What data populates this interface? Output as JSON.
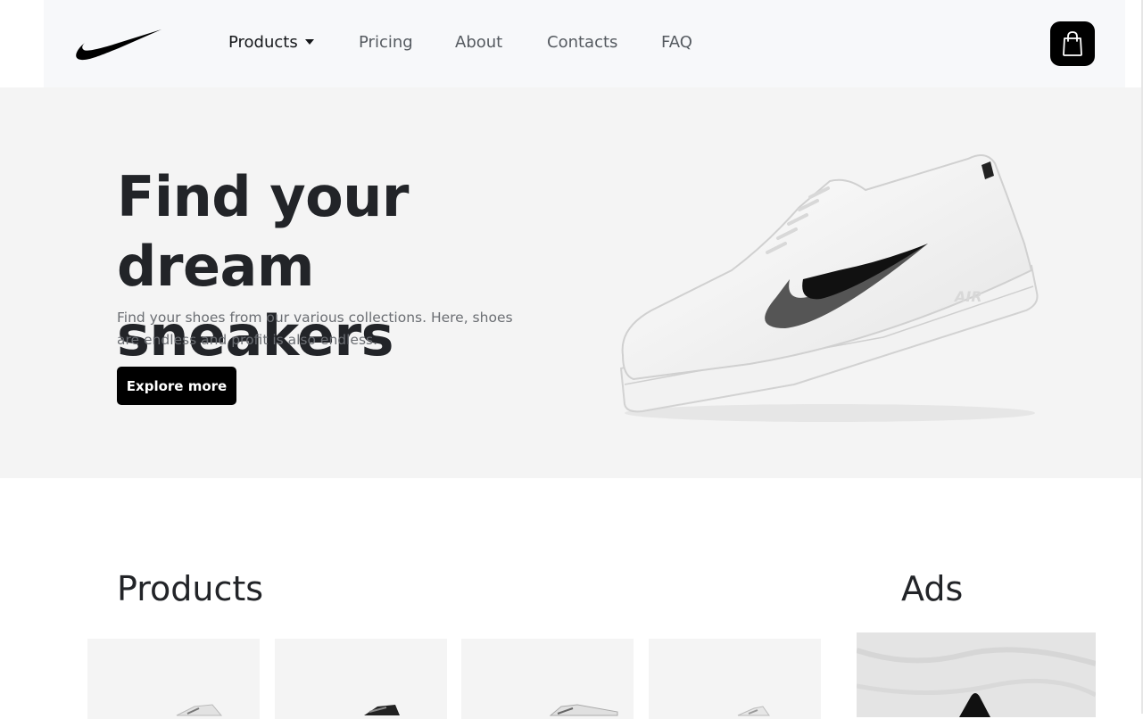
{
  "nav": {
    "logo_icon": "nike-swoosh-logo",
    "items": [
      {
        "label": "Products",
        "active": true,
        "has_dropdown": true
      },
      {
        "label": "Pricing"
      },
      {
        "label": "About"
      },
      {
        "label": "Contacts"
      },
      {
        "label": "FAQ"
      }
    ],
    "cart_icon": "shopping-bag-icon"
  },
  "hero": {
    "title": "Find your dream sneakers",
    "subtitle": "Find your shoes from our various collections. Here, shoes are endless and profit is also endless.",
    "button_label": "Explore more",
    "image_icon": "white-sneaker-image"
  },
  "products": {
    "title": "Products",
    "cards": [
      {
        "image": "sneaker-image-1"
      },
      {
        "image": "sneaker-image-2"
      },
      {
        "image": "sneaker-image-3"
      },
      {
        "image": "sneaker-image-4"
      }
    ]
  },
  "ads": {
    "title": "Ads",
    "image": "ad-image"
  },
  "colors": {
    "accent": "#000000",
    "navbar_bg": "#f7f8fa",
    "hero_bg": "#f4f4f4",
    "text_dark": "#222428",
    "text_muted": "#6b6e73"
  }
}
